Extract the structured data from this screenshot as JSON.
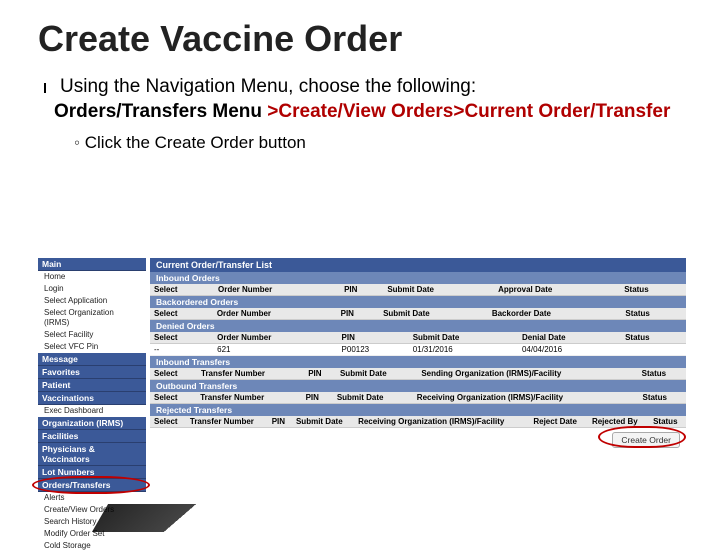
{
  "title": "Create Vaccine Order",
  "bullet1": "Using the Navigation Menu, choose the following:",
  "navpath": {
    "part1": "Orders/Transfers Menu ",
    "part2": ">Create/View Orders>Current Order/Transfer"
  },
  "bullet2": "Click the Create Order button",
  "sidebar": {
    "sections": [
      {
        "label": "Main",
        "items": [
          "Home",
          "Login",
          "Select Application",
          "Select Organization (IRMS)",
          "Select Facility",
          "Select VFC Pin"
        ]
      },
      {
        "label": "Message",
        "items": []
      },
      {
        "label": "Favorites",
        "items": []
      },
      {
        "label": "Patient",
        "items": []
      },
      {
        "label": "Vaccinations",
        "items": [
          "Exec Dashboard"
        ]
      },
      {
        "label": "Organization (IRMS)",
        "items": []
      },
      {
        "label": "Facilities",
        "items": []
      },
      {
        "label": "Physicians & Vaccinators",
        "items": []
      },
      {
        "label": "Lot Numbers",
        "items": []
      },
      {
        "label": "Orders/Transfers",
        "items": [
          "Alerts",
          "Create/View Orders",
          "Search History",
          "Modify Order Set",
          "Cold Storage"
        ]
      }
    ]
  },
  "main": {
    "panelTitle": "Current Order/Transfer List",
    "blocks": [
      {
        "bar": "Inbound Orders",
        "headers": [
          "Select",
          "Order Number",
          "PIN",
          "Submit Date",
          "Approval Date",
          "Status"
        ],
        "rows": []
      },
      {
        "bar": "Backordered Orders",
        "headers": [
          "Select",
          "Order Number",
          "PIN",
          "Submit Date",
          "Backorder Date",
          "Status"
        ],
        "rows": []
      },
      {
        "bar": "Denied Orders",
        "headers": [
          "Select",
          "Order Number",
          "PIN",
          "Submit Date",
          "Denial Date",
          "Status"
        ],
        "rows": [
          [
            "--",
            "621",
            "P00123",
            "01/31/2016",
            "04/04/2016",
            ""
          ]
        ]
      },
      {
        "bar": "Inbound Transfers",
        "headers": [
          "Select",
          "Transfer Number",
          "PIN",
          "Submit Date",
          "Sending Organization (IRMS)/Facility",
          "Status"
        ],
        "rows": []
      },
      {
        "bar": "Outbound Transfers",
        "headers": [
          "Select",
          "Transfer Number",
          "PIN",
          "Submit Date",
          "Receiving Organization (IRMS)/Facility",
          "Status"
        ],
        "rows": []
      },
      {
        "bar": "Rejected Transfers",
        "headers": [
          "Select",
          "Transfer Number",
          "PIN",
          "Submit Date",
          "Receiving Organization (IRMS)/Facility",
          "Reject Date",
          "Rejected By",
          "Status"
        ],
        "rows": []
      }
    ],
    "createButton": "Create Order"
  },
  "highlightedSidebarIndex": 9
}
